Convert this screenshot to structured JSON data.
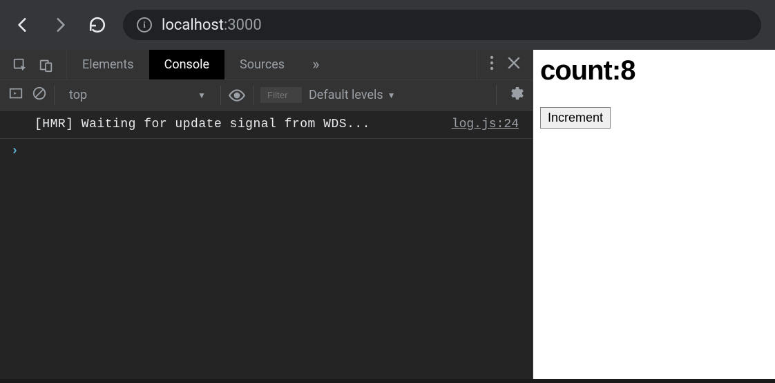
{
  "browser": {
    "url_host": "localhost",
    "url_port": ":3000"
  },
  "devtools": {
    "tabs": {
      "elements": "Elements",
      "console": "Console",
      "sources": "Sources"
    },
    "more_glyph": "»",
    "console_toolbar": {
      "context": "top",
      "filter_placeholder": "Filter",
      "levels_label": "Default levels"
    },
    "log": {
      "message": "[HMR] Waiting for update signal from WDS...",
      "source": "log.js:24"
    },
    "prompt_glyph": "›"
  },
  "app": {
    "heading": "count:8",
    "button_label": "Increment"
  }
}
